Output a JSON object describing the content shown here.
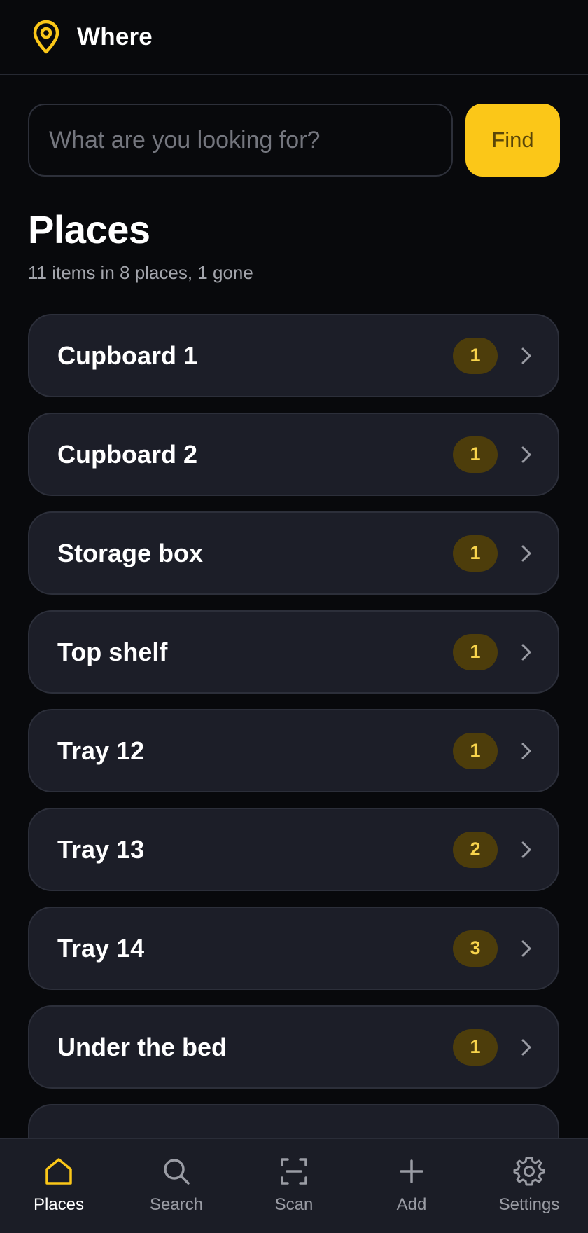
{
  "app": {
    "title": "Where",
    "logo_icon": "map-pin-icon",
    "accent_color": "#fbc718"
  },
  "search": {
    "placeholder": "What are you looking for?",
    "value": "",
    "button_label": "Find"
  },
  "places": {
    "title": "Places",
    "subtitle": "11 items in 8 places, 1 gone",
    "items": [
      {
        "name": "Cupboard 1",
        "count": "1"
      },
      {
        "name": "Cupboard 2",
        "count": "1"
      },
      {
        "name": "Storage box",
        "count": "1"
      },
      {
        "name": "Top shelf",
        "count": "1"
      },
      {
        "name": "Tray 12",
        "count": "1"
      },
      {
        "name": "Tray 13",
        "count": "2"
      },
      {
        "name": "Tray 14",
        "count": "3"
      },
      {
        "name": "Under the bed",
        "count": "1"
      }
    ]
  },
  "bottom_nav": {
    "items": [
      {
        "label": "Places",
        "icon": "home-icon",
        "active": true
      },
      {
        "label": "Search",
        "icon": "search-icon",
        "active": false
      },
      {
        "label": "Scan",
        "icon": "scan-icon",
        "active": false
      },
      {
        "label": "Add",
        "icon": "plus-icon",
        "active": false
      },
      {
        "label": "Settings",
        "icon": "gear-icon",
        "active": false
      }
    ]
  }
}
